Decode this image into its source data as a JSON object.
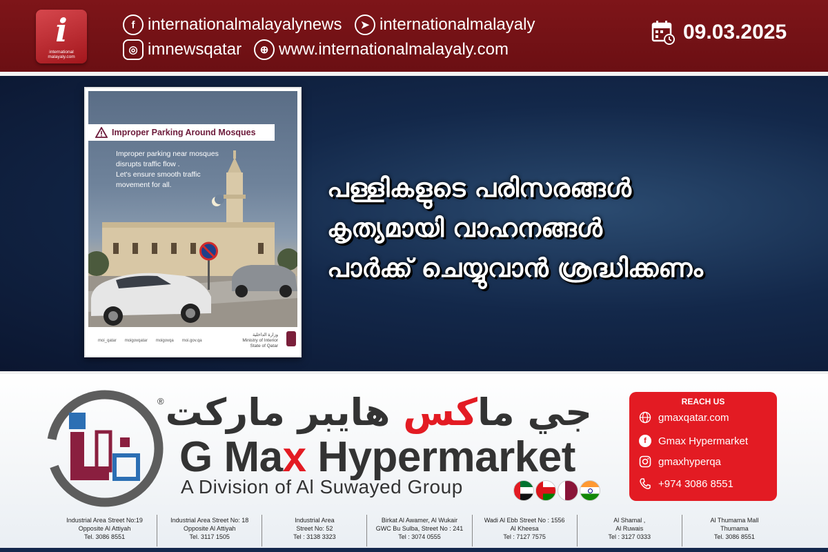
{
  "header": {
    "logo_text": "international malayaly.com",
    "social": [
      {
        "icon": "facebook-icon",
        "glyph": "f",
        "handle": "internationalmalayalynews"
      },
      {
        "icon": "telegram-icon",
        "glyph": "➤",
        "handle": "internationalmalayaly"
      },
      {
        "icon": "instagram-icon",
        "glyph": "◎",
        "handle": "imnewsqatar"
      },
      {
        "icon": "web-icon",
        "glyph": "⊕",
        "handle": "www.internationalmalayaly.com"
      }
    ],
    "date": "09.03.2025"
  },
  "poster": {
    "title": "Improper Parking Around Mosques",
    "body": [
      "Improper parking near mosques",
      "disrupts traffic flow .",
      "Let's ensure smooth traffic",
      "movement for all."
    ],
    "footer": [
      "moi_qatar",
      "moigovqatar",
      "moigovqa",
      "moi.gov.qa"
    ],
    "ministry_ar": "وزارة الداخلية",
    "ministry_en": "Ministry of Interior",
    "state": "State of Qatar"
  },
  "headline": [
    "പള്ളികളുടെ പരിസരങ്ങൾ",
    "കൃത്യമായി വാഹനങ്ങൾ",
    "പാർക്ക് ചെയ്യുവാൻ ശ്രദ്ധിക്കണം"
  ],
  "ad": {
    "registered": "®",
    "arabic_pre": "جي ما",
    "arabic_red": "كس",
    "arabic_post": " هايبر ماركت",
    "brand_pre": "G Ma",
    "brand_red": "x",
    "brand_post": " Hypermarket",
    "division": "A Division of Al Suwayed Group",
    "reach_title": "REACH US",
    "contacts": [
      {
        "icon": "globe-icon",
        "text": "gmaxqatar.com"
      },
      {
        "icon": "facebook-icon",
        "text": "Gmax Hypermarket"
      },
      {
        "icon": "instagram-icon",
        "text": "gmaxhyperqa"
      },
      {
        "icon": "phone-icon",
        "text": "+974 3086 8551"
      }
    ],
    "branches": [
      [
        "Industrial Area Street No:19",
        "Opposite Al Attiyah",
        "Tel. 3086 8551"
      ],
      [
        "Industrial Area Street No: 18",
        "Opposite Al Attiyah",
        "Tel. 3117 1505"
      ],
      [
        "Industrial Area",
        "Street No: 52",
        "Tel : 3138 3323"
      ],
      [
        "Birkat Al Awamer, Al Wukair",
        "GWC Bu Sulba, Street No : 241",
        "Tel : 3074 0555"
      ],
      [
        "Wadi Al Ebb Street No : 1556",
        "Al Kheesa",
        "Tel : 7127 7575"
      ],
      [
        "Al Shamal ,",
        "Al Ruwais",
        "Tel : 3127 0333"
      ],
      [
        "Al Thumama Mall",
        "Thumama",
        "Tel. 3086 8551"
      ]
    ]
  }
}
